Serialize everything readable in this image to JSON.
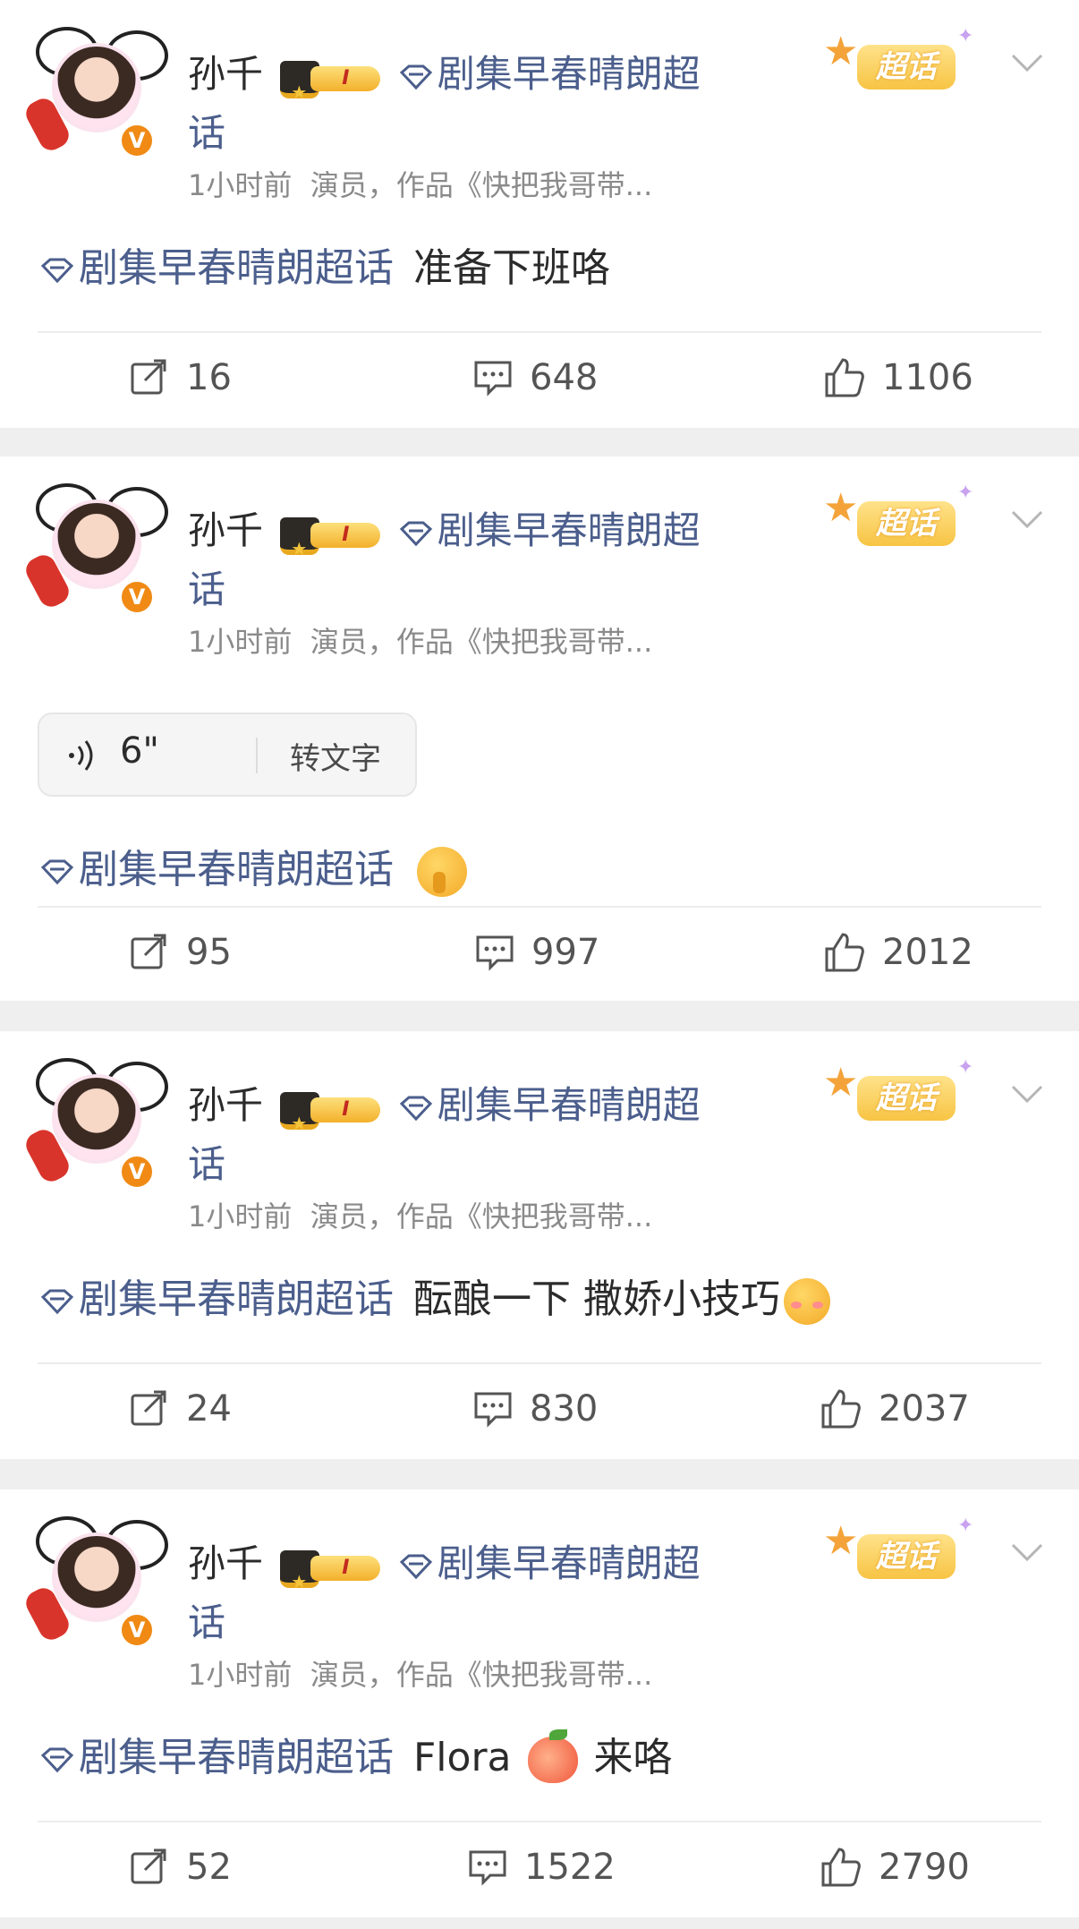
{
  "posts": [
    {
      "author": "孙千",
      "level": "I",
      "topic_name": "剧集早春晴朗超话",
      "time": "1小时前",
      "bio": "演员，作品《快把我哥带...",
      "badge": "超话",
      "content_topic": "剧集早春晴朗超话",
      "content_text": "准备下班咯",
      "reposts": "16",
      "comments": "648",
      "likes": "1106"
    },
    {
      "author": "孙千",
      "level": "I",
      "topic_name": "剧集早春晴朗超话",
      "time": "1小时前",
      "bio": "演员，作品《快把我哥带...",
      "badge": "超话",
      "voice_duration": "6\"",
      "voice_convert": "转文字",
      "content_topic": "剧集早春晴朗超话",
      "content_text": "",
      "emoji": "shushing-face-emoji",
      "reposts": "95",
      "comments": "997",
      "likes": "2012"
    },
    {
      "author": "孙千",
      "level": "I",
      "topic_name": "剧集早春晴朗超话",
      "time": "1小时前",
      "bio": "演员，作品《快把我哥带...",
      "badge": "超话",
      "content_topic": "剧集早春晴朗超话",
      "content_text": "酝酿一下 撒娇小技巧",
      "emoji": "blushing-face-emoji",
      "reposts": "24",
      "comments": "830",
      "likes": "2037"
    },
    {
      "author": "孙千",
      "level": "I",
      "topic_name": "剧集早春晴朗超话",
      "time": "1小时前",
      "bio": "演员，作品《快把我哥带...",
      "badge": "超话",
      "content_topic": "剧集早春晴朗超话",
      "content_text_a": "Flora",
      "emoji": "peach-emoji",
      "content_text_b": "来咯",
      "reposts": "52",
      "comments": "1522",
      "likes": "2790"
    }
  ],
  "icons": {
    "repost": "repost-icon",
    "comment": "comment-icon",
    "like": "like-icon",
    "menu": "chevron-down-icon",
    "verified": "verified-badge-icon",
    "topic": "diamond-topic-icon",
    "voice": "voice-wave-icon"
  },
  "colors": {
    "topic_blue": "#4b5e8c",
    "verified_orange": "#f08a14",
    "badge_gold": "#f7c444",
    "page_bg": "#efefef"
  }
}
